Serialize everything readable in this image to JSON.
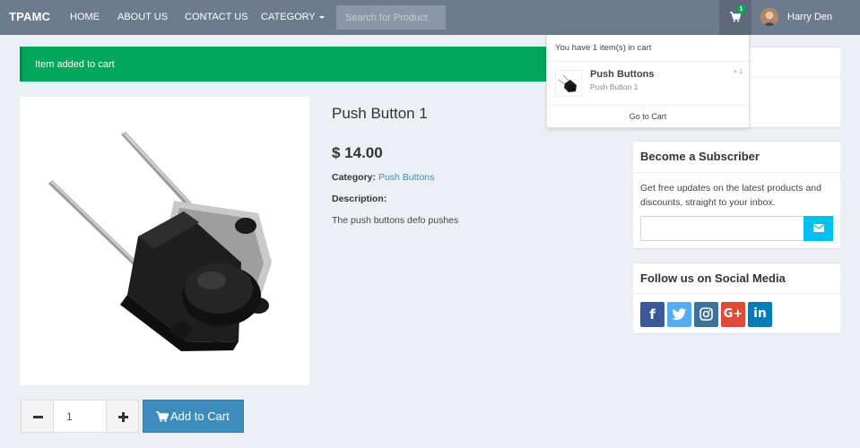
{
  "navbar": {
    "brand": "TPAMC",
    "links": [
      "HOME",
      "ABOUT US",
      "CONTACT US",
      "CATEGORY"
    ],
    "search_placeholder": "Search for Product",
    "cart_count": "1",
    "user_name": "Harry Den"
  },
  "alert": {
    "message": "Item added to cart"
  },
  "cart_dropdown": {
    "header": "You have 1 item(s) in cart",
    "item_title": "Push Buttons",
    "item_subtitle": "Push Button 1",
    "item_qty": "× 1",
    "footer": "Go to Cart"
  },
  "product": {
    "title": "Push Button 1",
    "price": "$ 14.00",
    "category_label": "Category:",
    "category_value": "Push Buttons",
    "description_label": "Description:",
    "description": "The push buttons defo pushes"
  },
  "quantity": {
    "value": "1",
    "add_label": "Add to Cart"
  },
  "subscriber": {
    "title": "Become a Subscriber",
    "text": "Get free updates on the latest products and discounts, straight to your inbox."
  },
  "social": {
    "title": "Follow us on Social Media",
    "icons": [
      "facebook-icon",
      "twitter-icon",
      "instagram-icon",
      "google-plus-icon",
      "linkedin-icon"
    ]
  },
  "colors": {
    "navbar": "#6d7b8f",
    "alert": "#00a65a",
    "primary": "#3c8dbc",
    "subscribe": "#00c0ef"
  }
}
